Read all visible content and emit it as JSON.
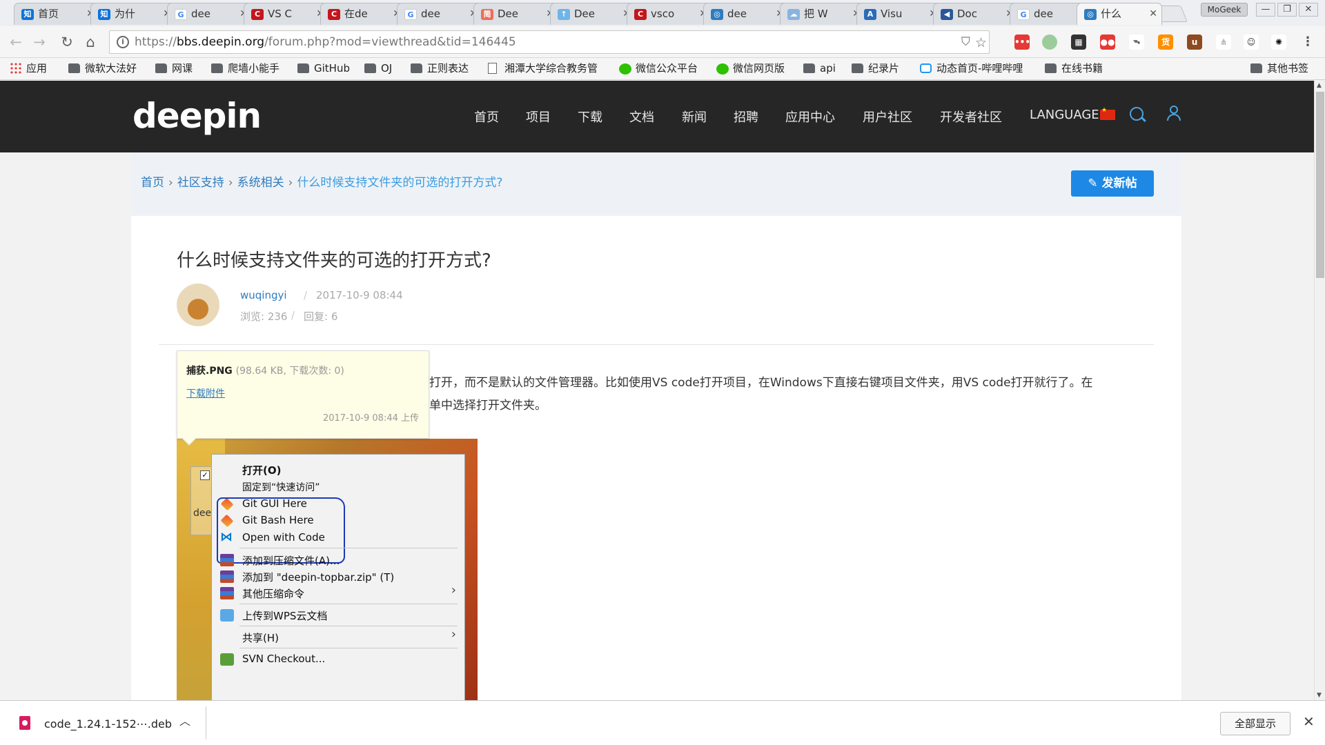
{
  "tabs": [
    {
      "label": "首页",
      "favicon": "知",
      "color": "#0e73d9"
    },
    {
      "label": "为什",
      "favicon": "知",
      "color": "#0e73d9"
    },
    {
      "label": "dee",
      "favicon": "G",
      "color": "#ffffff"
    },
    {
      "label": "VS C",
      "favicon": "C",
      "color": "#c4161c"
    },
    {
      "label": "在de",
      "favicon": "C",
      "color": "#c4161c"
    },
    {
      "label": "dee",
      "favicon": "G",
      "color": "#ffffff"
    },
    {
      "label": "Dee",
      "favicon": "简",
      "color": "#ea6f5a"
    },
    {
      "label": "Dee",
      "favicon": "↑",
      "color": "#6fb4e8"
    },
    {
      "label": "vsco",
      "favicon": "C",
      "color": "#c4161c"
    },
    {
      "label": "dee",
      "favicon": "◎",
      "color": "#2f7bbf"
    },
    {
      "label": "把 W",
      "favicon": "☁",
      "color": "#8ab4e0"
    },
    {
      "label": "Visu",
      "favicon": "A",
      "color": "#2b6cb8"
    },
    {
      "label": "Doc",
      "favicon": "◀",
      "color": "#2b5797"
    },
    {
      "label": "dee",
      "favicon": "G",
      "color": "#ffffff"
    },
    {
      "label": "什么",
      "favicon": "◎",
      "color": "#2f7bbf"
    }
  ],
  "window": {
    "profile_badge": "MoGeek"
  },
  "address_bar": {
    "scheme": "https://",
    "host": "bbs.deepin.org",
    "path": "/forum.php?mod=viewthread&tid=146445"
  },
  "bookmarks": [
    {
      "label": "应用",
      "icon": "apps-grid-icon"
    },
    {
      "label": "微软大法好",
      "icon": "folder-icon"
    },
    {
      "label": "网课",
      "icon": "folder-icon"
    },
    {
      "label": "爬墙小能手",
      "icon": "folder-icon"
    },
    {
      "label": "GitHub",
      "icon": "folder-icon"
    },
    {
      "label": "OJ",
      "icon": "folder-icon"
    },
    {
      "label": "正则表达",
      "icon": "folder-icon"
    },
    {
      "label": "湘潭大学综合教务管",
      "icon": "page-icon"
    },
    {
      "label": "微信公众平台",
      "icon": "wechat-icon"
    },
    {
      "label": "微信网页版",
      "icon": "wechat-icon"
    },
    {
      "label": "api",
      "icon": "folder-icon"
    },
    {
      "label": "纪录片",
      "icon": "folder-icon"
    },
    {
      "label": "动态首页-哔哩哔哩",
      "icon": "bilibili-icon"
    },
    {
      "label": "在线书籍",
      "icon": "folder-icon"
    }
  ],
  "other_bookmarks": "其他书签",
  "site": {
    "logo": "deepin",
    "nav": [
      "首页",
      "项目",
      "下载",
      "文档",
      "新闻",
      "招聘",
      "应用中心",
      "用户社区",
      "开发者社区"
    ],
    "language_label": "LANGUAGE:"
  },
  "breadcrumb": {
    "home": "首页",
    "section": "社区支持",
    "subsection": "系统相关",
    "current": "什么时候支持文件夹的可选的打开方式?"
  },
  "post_button": "发新帖",
  "thread": {
    "title": "什么时候支持文件夹的可选的打开方式?",
    "author": "wuqingyi",
    "date": "2017-10-9 08:44",
    "views": "浏览: 236",
    "replies": "回复: 6",
    "text_line1": "打开，而不是默认的文件管理器。比如使用VS code打开项目，在Windows下直接右键项目文件夹，用VS code打开就行了。在",
    "text_line2": "单中选择打开文件夹。"
  },
  "attachment": {
    "name": "捕获.PNG",
    "info": "(98.64 KB, 下载次数: 0)",
    "download": "下载附件",
    "uploaded": "2017-10-9 08:44 上传"
  },
  "screenshot_content": {
    "file_label": "dee",
    "menu": [
      "打开(O)",
      "固定到“快速访问”",
      "Git GUI Here",
      "Git Bash Here",
      "Open with Code",
      "添加到压缩文件(A)...",
      "添加到 \"deepin-topbar.zip\" (T)",
      "其他压缩命令",
      "上传到WPS云文档",
      "共享(H)",
      "SVN Checkout..."
    ]
  },
  "download": {
    "filename": "code_1.24.1-152⋯.deb",
    "show_all": "全部显示"
  }
}
